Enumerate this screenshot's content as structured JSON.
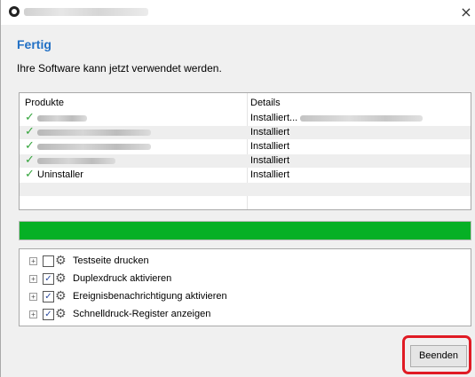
{
  "window": {
    "title_obscured": true,
    "close_glyph": "×",
    "icon": "app-logo-icon"
  },
  "header": {
    "title": "Fertig",
    "subtitle": "Ihre Software kann jetzt verwendet werden."
  },
  "table": {
    "columns": [
      "Produkte",
      "Details"
    ],
    "rows": [
      {
        "product": "",
        "product_obscured": true,
        "detail": "Installiert...",
        "detail_obscured_suffix": true,
        "status": "check-icon"
      },
      {
        "product": "",
        "product_obscured": true,
        "detail": "Installiert",
        "status": "check-icon"
      },
      {
        "product": "",
        "product_obscured": true,
        "detail": "Installiert",
        "status": "check-icon"
      },
      {
        "product": "",
        "product_obscured": true,
        "detail": "Installiert",
        "status": "check-icon"
      },
      {
        "product": "Uninstaller",
        "product_obscured": false,
        "detail": "Installiert",
        "status": "check-icon"
      }
    ]
  },
  "progress": {
    "percent": 100,
    "color": "#06b025"
  },
  "features": [
    {
      "label": "Testseite drucken",
      "checked": false
    },
    {
      "label": "Duplexdruck aktivieren",
      "checked": true
    },
    {
      "label": "Ereignisbenachrichtigung aktivieren",
      "checked": true
    },
    {
      "label": "Schnelldruck-Register anzeigen",
      "checked": true
    }
  ],
  "footer": {
    "finish_label": "Beenden",
    "highlight_color": "#e01b24"
  },
  "colors": {
    "heading": "#2371c5",
    "checkmark": "#35a53d"
  }
}
